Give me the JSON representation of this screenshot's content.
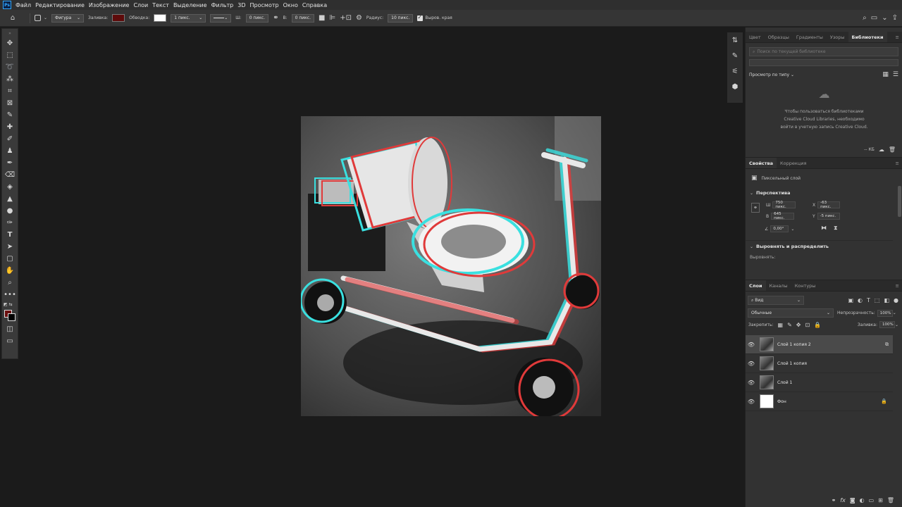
{
  "app": {
    "logo": "Ps"
  },
  "menu": [
    "Файл",
    "Редактирование",
    "Изображение",
    "Слои",
    "Текст",
    "Выделение",
    "Фильтр",
    "3D",
    "Просмотр",
    "Окно",
    "Справка"
  ],
  "options": {
    "shape_mode": "Фигура",
    "fill_label": "Заливка:",
    "stroke_label": "Обводка:",
    "stroke_width": "1 пикс.",
    "w_label": "Ш:",
    "w_value": "0 пикс.",
    "h_label": "В:",
    "h_value": "0 пикс.",
    "radius_label": "Радиус:",
    "radius_value": "10 пикс.",
    "align_edges": "Выров. края",
    "fill_color": "#5e0b0b",
    "stroke_color": "#ffffff"
  },
  "libraries": {
    "tabs": [
      "Цвет",
      "Образцы",
      "Градиенты",
      "Узоры",
      "Библиотеки"
    ],
    "active_tab": "Библиотеки",
    "search_placeholder": "Поиск по текущей библиотеке",
    "view_by": "Просмотр по типу",
    "message_1": "Чтобы пользоваться библиотеками",
    "message_2": "Creative Cloud Libraries, необходимо",
    "message_3": "войти в учетную запись Creative Cloud.",
    "size": "-- КБ"
  },
  "properties": {
    "tabs": [
      "Свойства",
      "Коррекция"
    ],
    "layer_type": "Пиксельный слой",
    "perspective_title": "Перспектива",
    "w_label": "Ш",
    "w_value": "750 пикс.",
    "x_label": "X",
    "x_value": "-63 пикс.",
    "h_label": "В",
    "h_value": "645 пикс.",
    "y_label": "Y",
    "y_value": "-5 пикс.",
    "angle_value": "0,00°",
    "align_title": "Выровнять и распределить",
    "align_label": "Выровнять:"
  },
  "layers": {
    "tabs": [
      "Слои",
      "Каналы",
      "Контуры"
    ],
    "filter": "Вид",
    "blend_mode": "Обычные",
    "opacity_label": "Непрозрачность:",
    "opacity_value": "100%",
    "lock_label": "Закрепить:",
    "fill_label": "Заливка:",
    "fill_value": "100%",
    "items": [
      {
        "name": "Слой 1 копия 2",
        "active": true
      },
      {
        "name": "Слой 1 копия",
        "active": false
      },
      {
        "name": "Слой 1",
        "active": false
      },
      {
        "name": "Фон",
        "active": false
      }
    ]
  }
}
